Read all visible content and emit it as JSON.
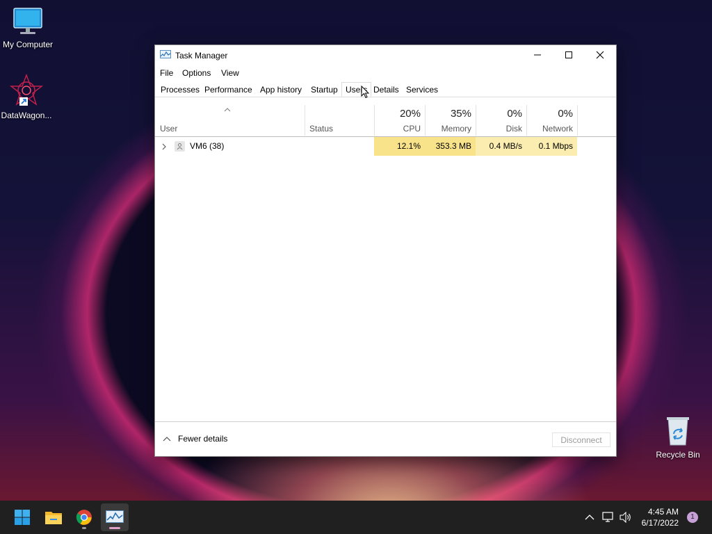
{
  "desktop": {
    "icons": [
      {
        "label": "My Computer"
      },
      {
        "label": "DataWagon..."
      },
      {
        "label": "Recycle Bin"
      }
    ]
  },
  "window": {
    "title": "Task Manager",
    "controls": {
      "minimize": "minimize-icon",
      "maximize": "maximize-icon",
      "close": "close-icon"
    }
  },
  "menu": [
    "File",
    "Options",
    "View"
  ],
  "tabs": [
    "Processes",
    "Performance",
    "App history",
    "Startup",
    "Users",
    "Details",
    "Services"
  ],
  "active_tab": "Users",
  "columns": {
    "user": "User",
    "status": "Status",
    "cpu": {
      "pct": "20%",
      "label": "CPU"
    },
    "memory": {
      "pct": "35%",
      "label": "Memory"
    },
    "disk": {
      "pct": "0%",
      "label": "Disk"
    },
    "network": {
      "pct": "0%",
      "label": "Network"
    }
  },
  "rows": [
    {
      "user": "VM6 (38)",
      "status": "",
      "cpu": "12.1%",
      "memory": "353.3 MB",
      "disk": "0.4 MB/s",
      "network": "0.1 Mbps"
    }
  ],
  "footer": {
    "fewer_details": "Fewer details",
    "disconnect": "Disconnect"
  },
  "taskbar": {
    "apps": [
      "start-icon",
      "file-explorer-icon",
      "chrome-icon",
      "task-manager-icon"
    ],
    "tray": [
      "chevron-up-icon",
      "network-icon",
      "volume-icon"
    ],
    "time": "4:45 AM",
    "date": "6/17/2022",
    "notifications": "1"
  },
  "colors": {
    "heat_cpu": "#f9e38a",
    "heat_low": "#fbedb0",
    "accent": "#0078d4",
    "taskbar": "#202020"
  }
}
